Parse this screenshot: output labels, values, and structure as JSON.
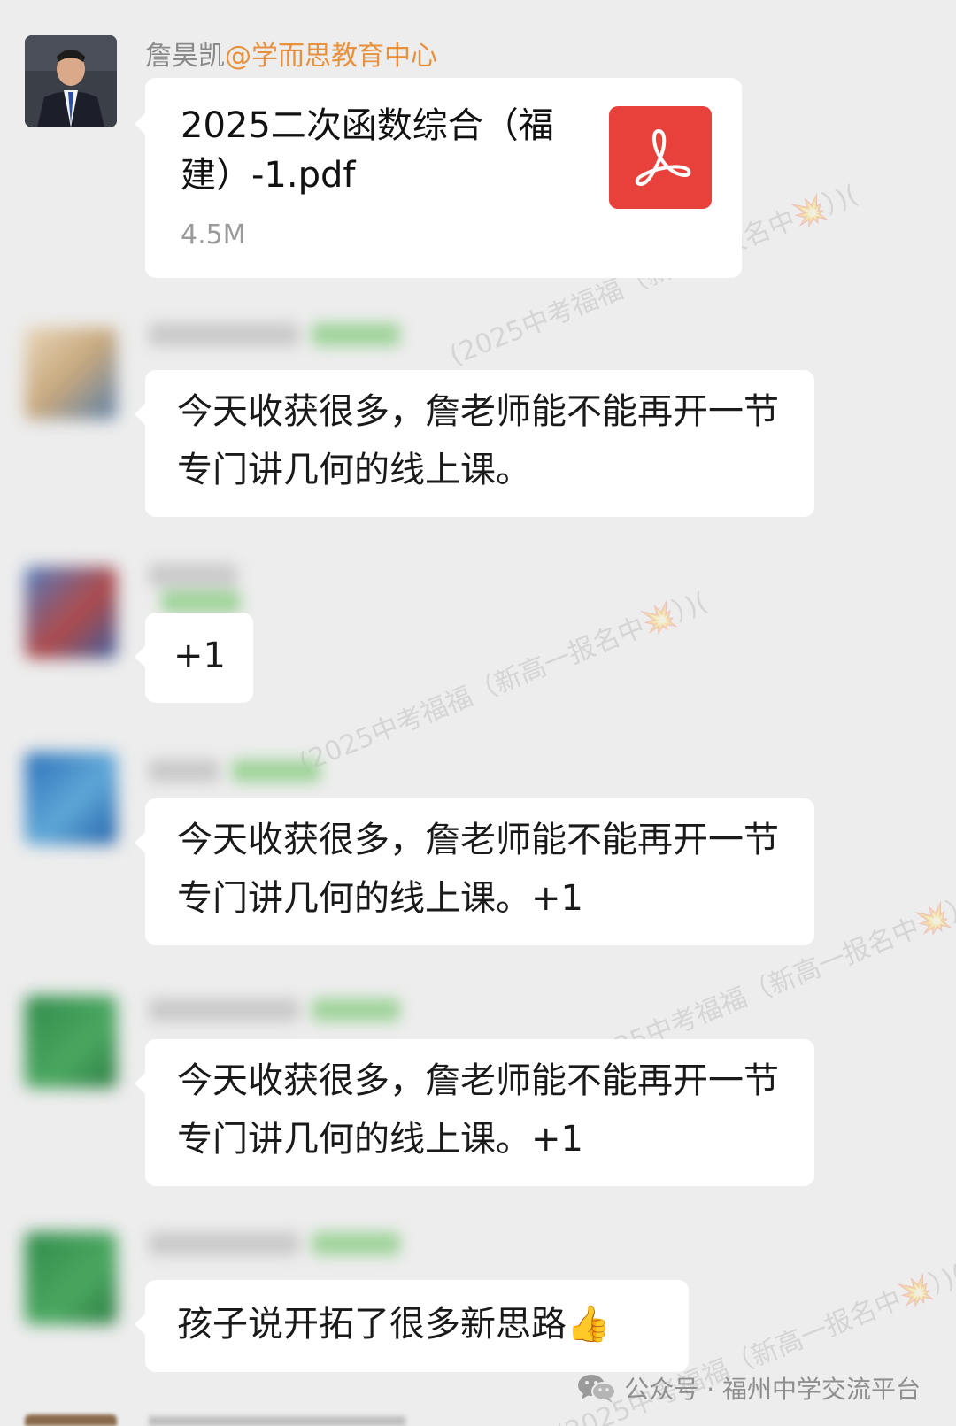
{
  "messages": [
    {
      "sender_name": "詹昊凯",
      "sender_mention": "@学而思教育中心",
      "file_name": "2025二次函数综合（福建）-1.pdf",
      "file_size": "4.5M",
      "file_icon": "pdf-icon"
    },
    {
      "text": "今天收获很多，詹老师能不能再开一节专门讲几何的线上课。"
    },
    {
      "text": "+1"
    },
    {
      "text": "今天收获很多，詹老师能不能再开一节专门讲几何的线上课。+1"
    },
    {
      "text": "今天收获很多，詹老师能不能再开一节专门讲几何的线上课。+1"
    },
    {
      "text": "孩子说开拓了很多新思路",
      "emoji": "👍"
    }
  ],
  "watermark_text": "(2025中考福福（新高一报名中💥）)(",
  "footer": {
    "icon": "wechat-icon",
    "label": "公众号 · 福州中学交流平台"
  }
}
